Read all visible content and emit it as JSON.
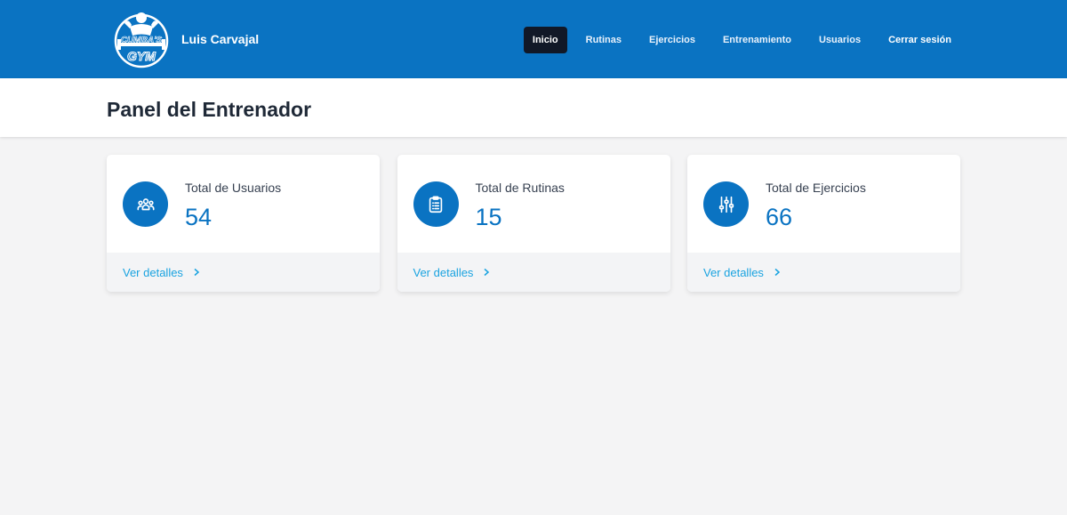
{
  "brand": {
    "name": "Luis Carvajal",
    "logo_icon": "gym-logo-icon",
    "logo_text_top": "CUMBA'S",
    "logo_text_bottom": "GYM"
  },
  "nav": {
    "items": [
      {
        "label": "Inicio",
        "active": true
      },
      {
        "label": "Rutinas",
        "active": false
      },
      {
        "label": "Ejercicios",
        "active": false
      },
      {
        "label": "Entrenamiento",
        "active": false
      },
      {
        "label": "Usuarios",
        "active": false
      }
    ],
    "logout_label": "Cerrar sesión"
  },
  "page": {
    "title": "Panel del Entrenador"
  },
  "cards": [
    {
      "label": "Total de Usuarios",
      "value": "54",
      "link": "Ver detalles",
      "icon": "users-group-icon"
    },
    {
      "label": "Total de Rutinas",
      "value": "15",
      "link": "Ver detalles",
      "icon": "clipboard-list-icon"
    },
    {
      "label": "Total de Ejercicios",
      "value": "66",
      "link": "Ver detalles",
      "icon": "sliders-icon"
    }
  ],
  "colors": {
    "primary": "#0a73c2",
    "active_nav": "#111827",
    "link": "#1aa3e0",
    "background": "#f4f4f5"
  }
}
